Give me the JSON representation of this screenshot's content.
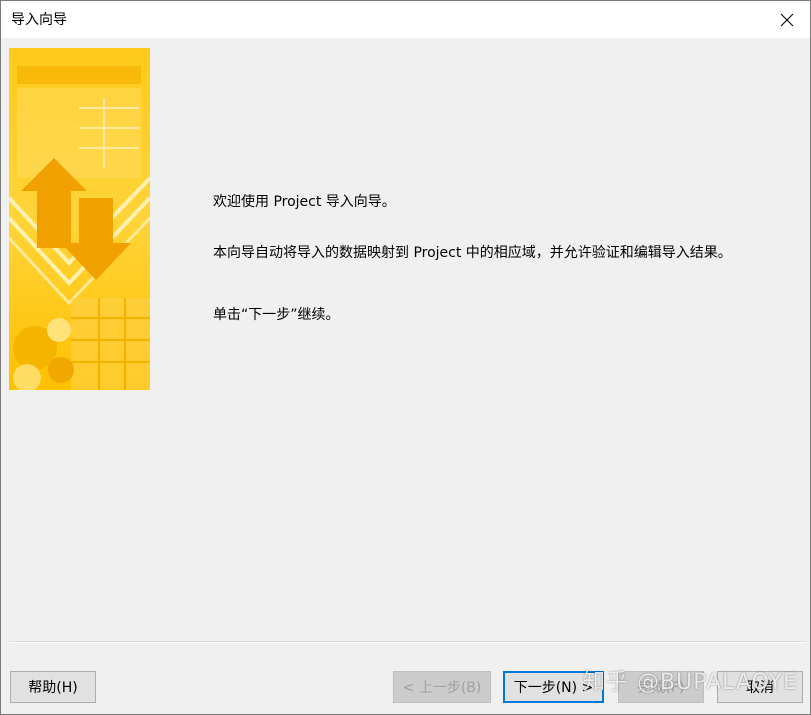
{
  "window": {
    "title": "导入向导"
  },
  "content": {
    "welcome": "欢迎使用 Project 导入向导。",
    "description": "本向导自动将导入的数据映射到 Project 中的相应域，并允许验证和编辑导入结果。",
    "instruction": "单击“下一步”继续。"
  },
  "buttons": {
    "help": "帮助(H)",
    "prev": "< 上一步(B)",
    "next": "下一步(N) >",
    "finish": "完成(F)",
    "cancel": "取消"
  },
  "watermark": "知乎 @BUPALAOYE",
  "colors": {
    "banner_primary": "#ffc200",
    "banner_light": "#ffe27a",
    "banner_dark": "#f0a800",
    "default_button_border": "#0078d7"
  },
  "icons": {
    "close": "close-icon"
  }
}
